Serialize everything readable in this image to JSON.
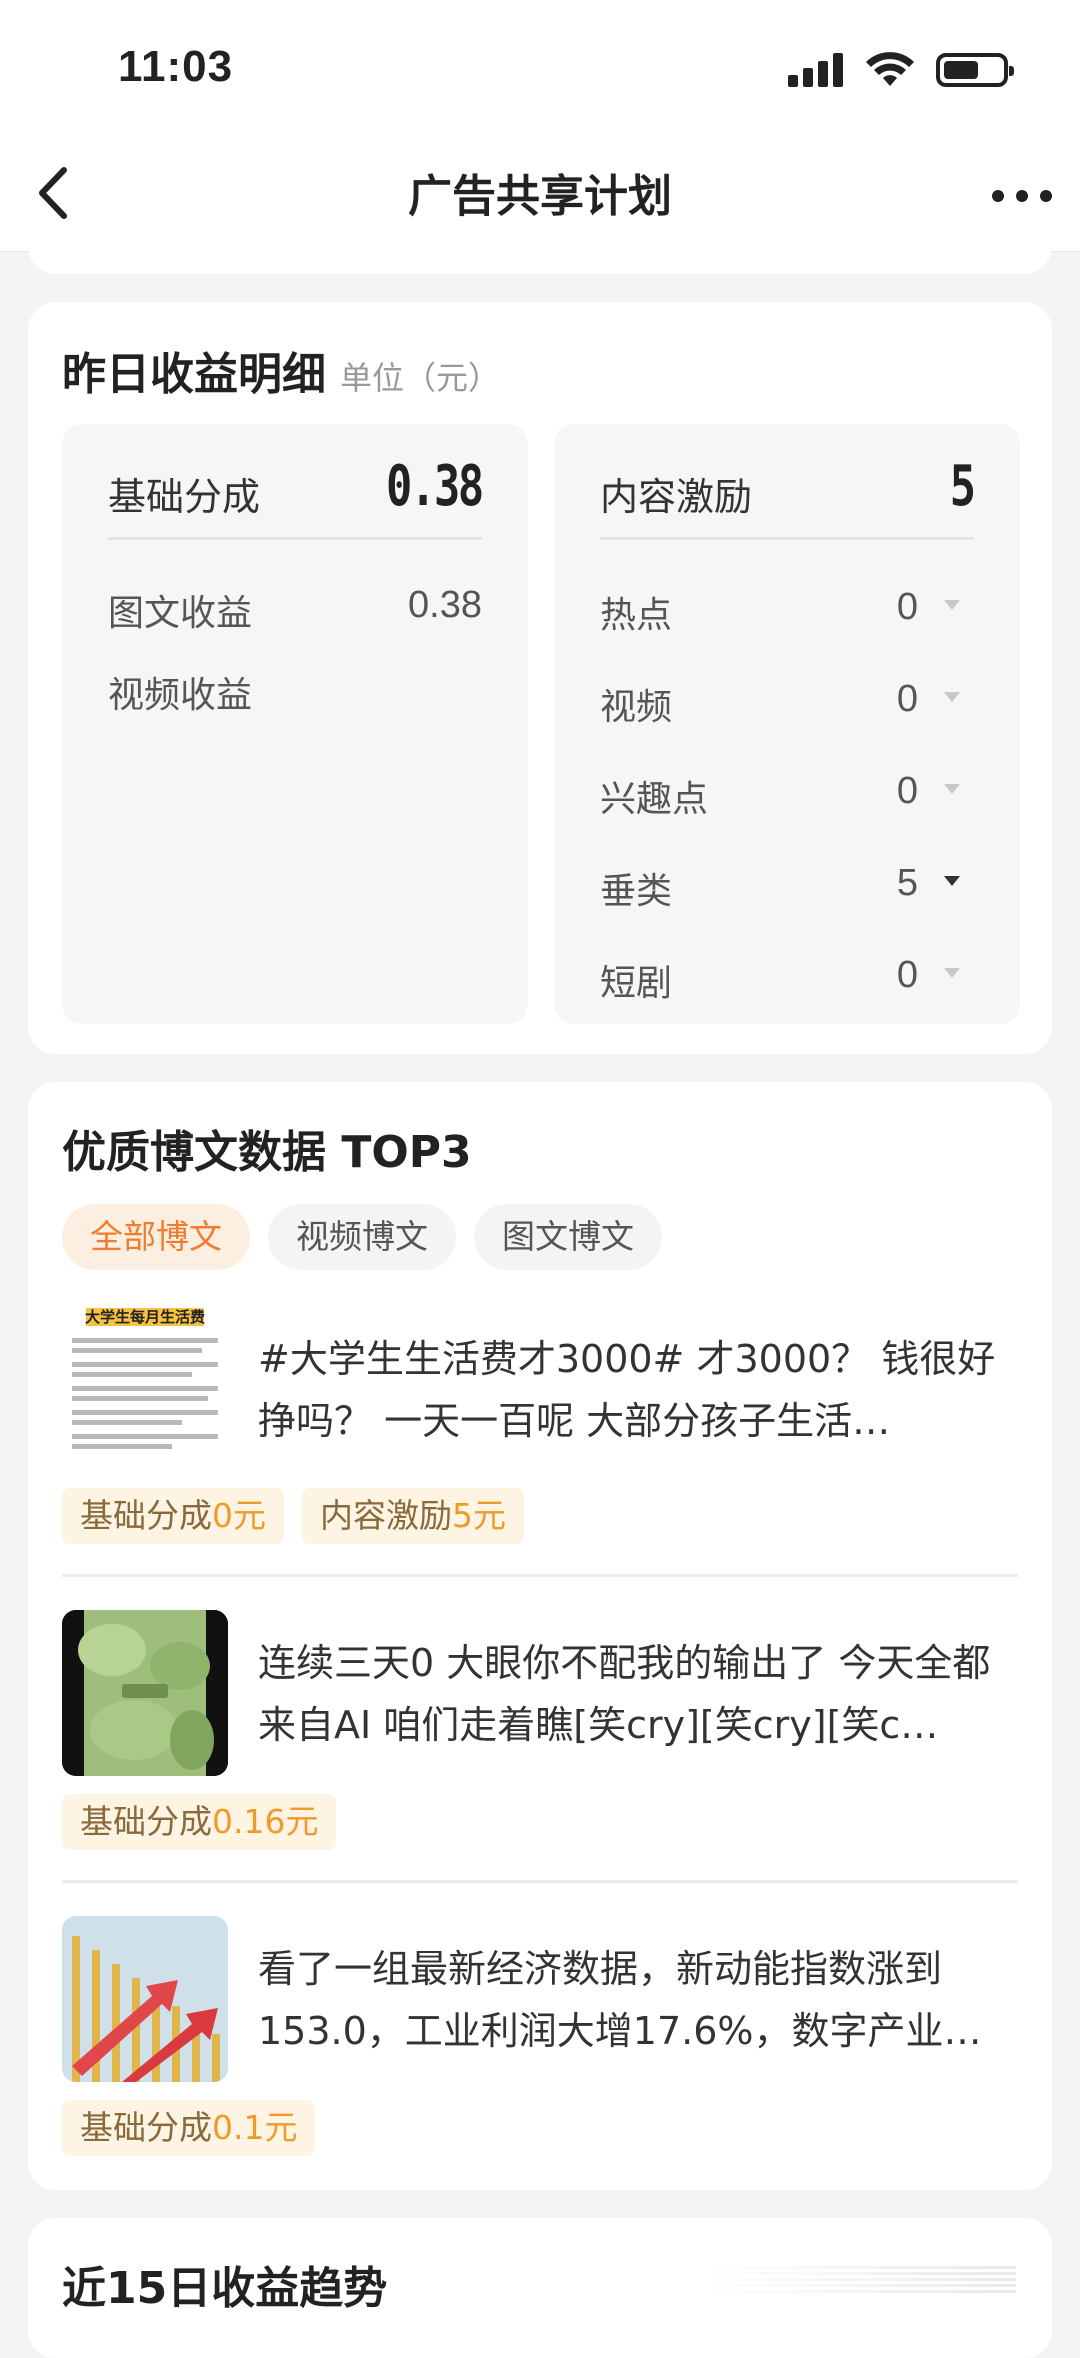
{
  "status": {
    "time": "11:03"
  },
  "header": {
    "title": "广告共享计划"
  },
  "earnings": {
    "title": "昨日收益明细",
    "unit": "单位（元）",
    "base": {
      "label": "基础分成",
      "value": "0.38",
      "rows": [
        {
          "label": "图文收益",
          "value": "0.38"
        },
        {
          "label": "视频收益",
          "value": ""
        }
      ]
    },
    "incentive": {
      "label": "内容激励",
      "value": "5",
      "rows": [
        {
          "label": "热点",
          "value": "0"
        },
        {
          "label": "视频",
          "value": "0"
        },
        {
          "label": "兴趣点",
          "value": "0"
        },
        {
          "label": "垂类",
          "value": "5"
        },
        {
          "label": "短剧",
          "value": "0"
        }
      ]
    }
  },
  "top3": {
    "title": "优质博文数据 TOP3",
    "filters": [
      "全部博文",
      "视频博文",
      "图文博文"
    ],
    "posts": [
      {
        "text": "#大学生生活费才3000# 才3000？ 钱很好挣吗？ 一天一百呢 大部分孩子生活…",
        "thumb_caption": "大学生每月生活费",
        "tags": [
          {
            "prefix": "基础分成",
            "amount": "0元"
          },
          {
            "prefix": "内容激励",
            "amount": "5元"
          }
        ]
      },
      {
        "text": "连续三天0 大眼你不配我的输出了 今天全都来自AI 咱们走着瞧[笑cry][笑cry][笑c…",
        "tags": [
          {
            "prefix": "基础分成",
            "amount": "0.16元"
          }
        ]
      },
      {
        "text": "看了一组最新经济数据，新动能指数涨到153.0，工业利润大增17.6%，数字产业…",
        "tags": [
          {
            "prefix": "基础分成",
            "amount": "0.1元"
          }
        ]
      }
    ]
  },
  "trend": {
    "title": "近15日收益趋势"
  }
}
